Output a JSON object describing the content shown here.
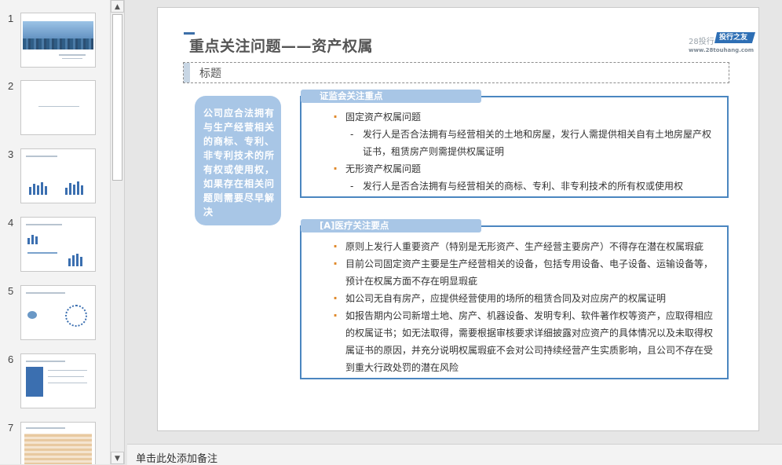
{
  "thumbnails": [
    {
      "number": "1"
    },
    {
      "number": "2"
    },
    {
      "number": "3"
    },
    {
      "number": "4"
    },
    {
      "number": "5"
    },
    {
      "number": "6"
    },
    {
      "number": "7"
    }
  ],
  "slide": {
    "title": "重点关注问题——资产权属",
    "logo": {
      "site": "28投行",
      "badge": "投行之友",
      "url": "www.28touhang.com"
    },
    "placeholder": "标题",
    "left_note": "公司应合法拥有与生产经营相关的商标、专利、非专利技术的所有权或使用权，如果存在相关问题则需要尽早解决",
    "panel1": {
      "tag": "证监会关注重点",
      "item1": "固定资产权属问题",
      "item1_sub": "发行人是否合法拥有与经营相关的土地和房屋，发行人需提供相关自有土地房屋产权证书，租赁房产则需提供权属证明",
      "item2": "无形资产权属问题",
      "item2_sub": "发行人是否合法拥有与经营相关的商标、专利、非专利技术的所有权或使用权"
    },
    "panel2": {
      "tag": "[A]医疗关注要点",
      "items": [
        "原则上发行人重要资产（特别是无形资产、生产经营主要房产）不得存在潜在权属瑕疵",
        "目前公司固定资产主要是生产经营相关的设备，包括专用设备、电子设备、运输设备等，预计在权属方面不存在明显瑕疵",
        "如公司无自有房产，应提供经营使用的场所的租赁合同及对应房产的权属证明",
        "如报告期内公司新增土地、房产、机器设备、发明专利、软件著作权等资产，应取得相应的权属证书；如无法取得，需要根据审核要求详细披露对应资产的具体情况以及未取得权属证书的原因，并充分说明权属瑕疵不会对公司持续经营产生实质影响，且公司不存在受到重大行政处罚的潜在风险"
      ]
    }
  },
  "notes": {
    "placeholder": "单击此处添加备注"
  },
  "colors": {
    "accent": "#4b86c0",
    "tag_fill": "#a8c6e6",
    "bullet": "#e08a2c"
  },
  "icons": {
    "scroll_up": "triangle-up-icon",
    "scroll_down": "triangle-down-icon"
  }
}
